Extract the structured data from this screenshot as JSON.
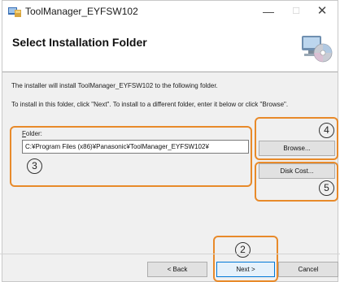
{
  "window": {
    "title": "ToolManager_EYFSW102",
    "minimize_glyph": "—",
    "maximize_glyph": "☐",
    "close_glyph": "✕"
  },
  "header": {
    "title": "Select Installation Folder"
  },
  "body": {
    "line1": "The installer will install ToolManager_EYFSW102 to the following folder.",
    "line2": "To install in this folder, click \"Next\". To install to a different folder, enter it below or click \"Browse\"."
  },
  "folder": {
    "label_underlined": "F",
    "label_rest": "older:",
    "value": "C:¥Program Files (x86)¥Panasonic¥ToolManager_EYFSW102¥"
  },
  "buttons": {
    "browse": "Browse...",
    "disk_cost": "Disk Cost...",
    "back": "< Back",
    "next": "Next >",
    "cancel": "Cancel"
  },
  "annotations": {
    "n2": "2",
    "n3": "3",
    "n4": "4",
    "n5": "5"
  },
  "colors": {
    "annotation_outline": "#e88a2a",
    "next_border": "#0078d7"
  }
}
